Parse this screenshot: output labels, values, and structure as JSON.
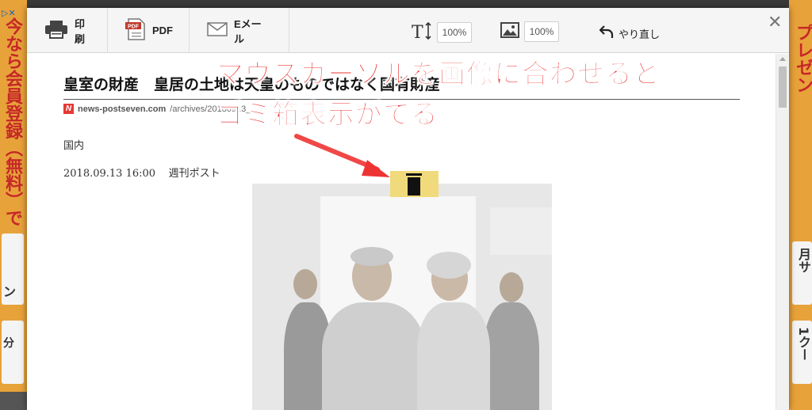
{
  "background": {
    "left_ad": {
      "badge": "▷✕",
      "vertical_text": "今なら会員登録（無料）で",
      "card1": "ン",
      "card2": "分"
    },
    "right_ad": {
      "vertical_text": "プレゼン",
      "card1": "月サ",
      "card2": "1クー"
    }
  },
  "toolbar": {
    "print_label": "印刷",
    "pdf_label": "PDF",
    "email_label": "Eメール",
    "text_size": "100%",
    "image_size": "100%",
    "undo_label": "やり直し",
    "close_glyph": "✕"
  },
  "article": {
    "title": "皇室の財産　皇居の土地は天皇のものではなく国有財産",
    "source_domain": "news-postseven.com",
    "source_path": "/archives/20180913_...",
    "category": "国内",
    "date": "2018.09.13 16:00",
    "publisher": "週刊ポスト"
  },
  "annotation": {
    "line1": "マウスカーソルを画像に合わせると",
    "line2": "ゴミ箱表示がでる",
    "color": "#ee3333"
  },
  "colors": {
    "toolbar_bg": "#f5f5f5",
    "trash_tab": "#f0da7c",
    "ad_orange": "#e8a23a",
    "ad_red": "#c62828"
  }
}
